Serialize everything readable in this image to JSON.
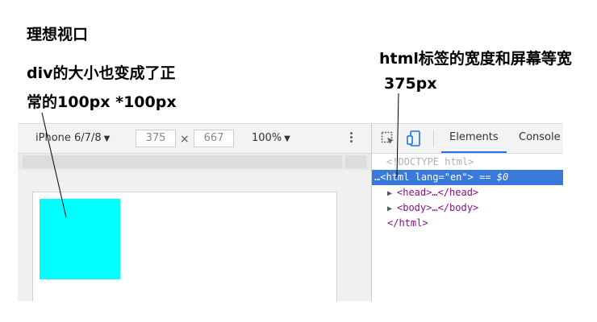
{
  "annotations": {
    "title": "理想视口",
    "div_note_line1": "div的大小也变成了正",
    "div_note_line2": "常的100px *100px",
    "html_note_line1": "html标签的宽度和屏幕等宽",
    "html_note_line2": "375px"
  },
  "toolbar": {
    "device_name": "iPhone 6/7/8",
    "width_value": "375",
    "height_value": "667",
    "times_sign": "×",
    "zoom": "100%",
    "caret": "▼"
  },
  "devtools": {
    "tabs": [
      "Elements",
      "Console"
    ],
    "active_tab": "Elements",
    "dom": {
      "doctype": "<!DOCTYPE html>",
      "ellipsis": "…",
      "html_open_tag": "<html",
      "lang_attr": "lang",
      "lang_value": "\"en\"",
      "selected_suffix": "> == ",
      "dollar_zero": "$0",
      "head_line": "<head>…</head>",
      "body_line": "<body>…</body>",
      "html_close": "</html>"
    }
  },
  "colors": {
    "div_fill": "#00ffff",
    "selection": "#3879d9",
    "active_tab_underline": "#1a73e8"
  },
  "icons": {
    "device": "caret-down",
    "more": "vertical-ellipsis",
    "inspect": "element-picker",
    "device_toggle": "device-mobile",
    "expand": "triangle-right"
  }
}
